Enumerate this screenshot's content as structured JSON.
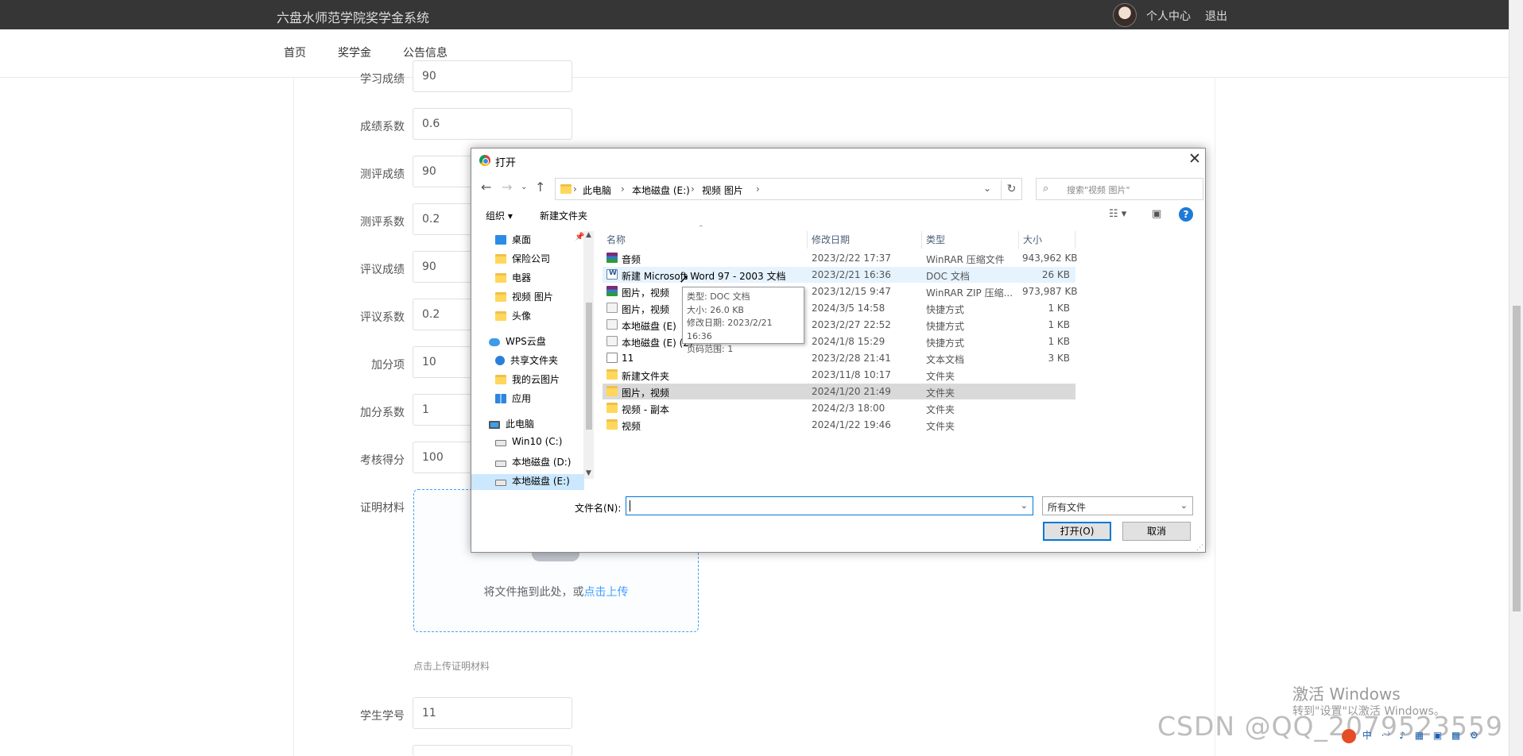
{
  "app": {
    "title": "六盘水师范学院奖学金系统"
  },
  "header": {
    "profile_label": "个人中心",
    "logout_label": "退出"
  },
  "nav": {
    "items": [
      "首页",
      "奖学金",
      "公告信息"
    ]
  },
  "form": {
    "rows": [
      {
        "label": "学习成绩",
        "value": "90"
      },
      {
        "label": "成绩系数",
        "value": "0.6"
      },
      {
        "label": "测评成绩",
        "value": "90"
      },
      {
        "label": "测评系数",
        "value": "0.2"
      },
      {
        "label": "评议成绩",
        "value": "90"
      },
      {
        "label": "评议系数",
        "value": "0.2"
      },
      {
        "label": "加分项",
        "value": "10"
      },
      {
        "label": "加分系数",
        "value": "1"
      },
      {
        "label": "考核得分",
        "value": "100"
      }
    ],
    "proof_label": "证明材料",
    "upload_text": "将文件拖到此处，或",
    "upload_link": "点击上传",
    "upload_tip": "点击上传证明材料",
    "student_id_label": "学生学号",
    "student_id_value": "11"
  },
  "dialog": {
    "title": "打开",
    "breadcrumb": [
      "此电脑",
      "本地磁盘 (E:)",
      "视频 图片"
    ],
    "search_placeholder": "搜索\"视频 图片\"",
    "organize_label": "组织 ▾",
    "new_folder_label": "新建文件夹",
    "tree": [
      {
        "label": "桌面",
        "icon": "desktop-icon"
      },
      {
        "label": "保险公司",
        "icon": "folder-icon"
      },
      {
        "label": "电器",
        "icon": "folder-icon"
      },
      {
        "label": "视频 图片",
        "icon": "folder-icon"
      },
      {
        "label": "头像",
        "icon": "folder-icon"
      },
      {
        "label": "WPS云盘",
        "icon": "cloud-icon"
      },
      {
        "label": "共享文件夹",
        "icon": "share-icon"
      },
      {
        "label": "我的云图片",
        "icon": "folder-icon"
      },
      {
        "label": "应用",
        "icon": "apps-icon"
      },
      {
        "label": "此电脑",
        "icon": "pc-icon"
      },
      {
        "label": "Win10 (C:)",
        "icon": "drive-icon"
      },
      {
        "label": "本地磁盘 (D:)",
        "icon": "drive-icon"
      },
      {
        "label": "本地磁盘 (E:)",
        "icon": "drive-icon"
      }
    ],
    "columns": [
      "名称",
      "修改日期",
      "类型",
      "大小"
    ],
    "files": [
      {
        "name": "音频",
        "date": "2023/2/22 17:37",
        "type": "WinRAR 压缩文件",
        "size": "943,962 KB",
        "icon": "rar-icon"
      },
      {
        "name": "新建 Microsoft Word 97 - 2003 文档",
        "date": "2023/2/21 16:36",
        "type": "DOC 文档",
        "size": "26 KB",
        "icon": "doc-icon"
      },
      {
        "name": "图片，视频",
        "date": "2023/12/15 9:47",
        "type": "WinRAR ZIP 压缩...",
        "size": "973,987 KB",
        "icon": "rar-icon"
      },
      {
        "name": "图片，视频",
        "date": "2024/3/5 14:58",
        "type": "快捷方式",
        "size": "1 KB",
        "icon": "shortcut-icon"
      },
      {
        "name": "本地磁盘 (E)",
        "date": "2023/2/27 22:52",
        "type": "快捷方式",
        "size": "1 KB",
        "icon": "shortcut-icon"
      },
      {
        "name": "本地磁盘 (E) (2)",
        "date": "2024/1/8 15:29",
        "type": "快捷方式",
        "size": "1 KB",
        "icon": "shortcut-icon"
      },
      {
        "name": "11",
        "date": "2023/2/28 21:41",
        "type": "文本文档",
        "size": "3 KB",
        "icon": "text-file-icon"
      },
      {
        "name": "新建文件夹",
        "date": "2023/11/8 10:17",
        "type": "文件夹",
        "size": "",
        "icon": "folder-icon"
      },
      {
        "name": "图片，视频",
        "date": "2024/1/20 21:49",
        "type": "文件夹",
        "size": "",
        "icon": "folder-icon"
      },
      {
        "name": "视频 - 副本",
        "date": "2024/2/3 18:00",
        "type": "文件夹",
        "size": "",
        "icon": "folder-icon"
      },
      {
        "name": "视频",
        "date": "2024/1/22 19:46",
        "type": "文件夹",
        "size": "",
        "icon": "folder-icon"
      }
    ],
    "tooltip": [
      "类型: DOC 文档",
      "大小: 26.0 KB",
      "修改日期: 2023/2/21 16:36",
      "页码范围: 1"
    ],
    "filename_label": "文件名(N):",
    "filename_value": "",
    "filetype_value": "所有文件",
    "open_label": "打开(O)",
    "cancel_label": "取消"
  },
  "watermark": {
    "line1": "激活 Windows",
    "line2": "转到\"设置\"以激活 Windows。"
  },
  "csdn": "CSDN @QQ_2079523559",
  "tray": "中 ·⁾ ♪ ▦ ▣ ▩ ⚙"
}
